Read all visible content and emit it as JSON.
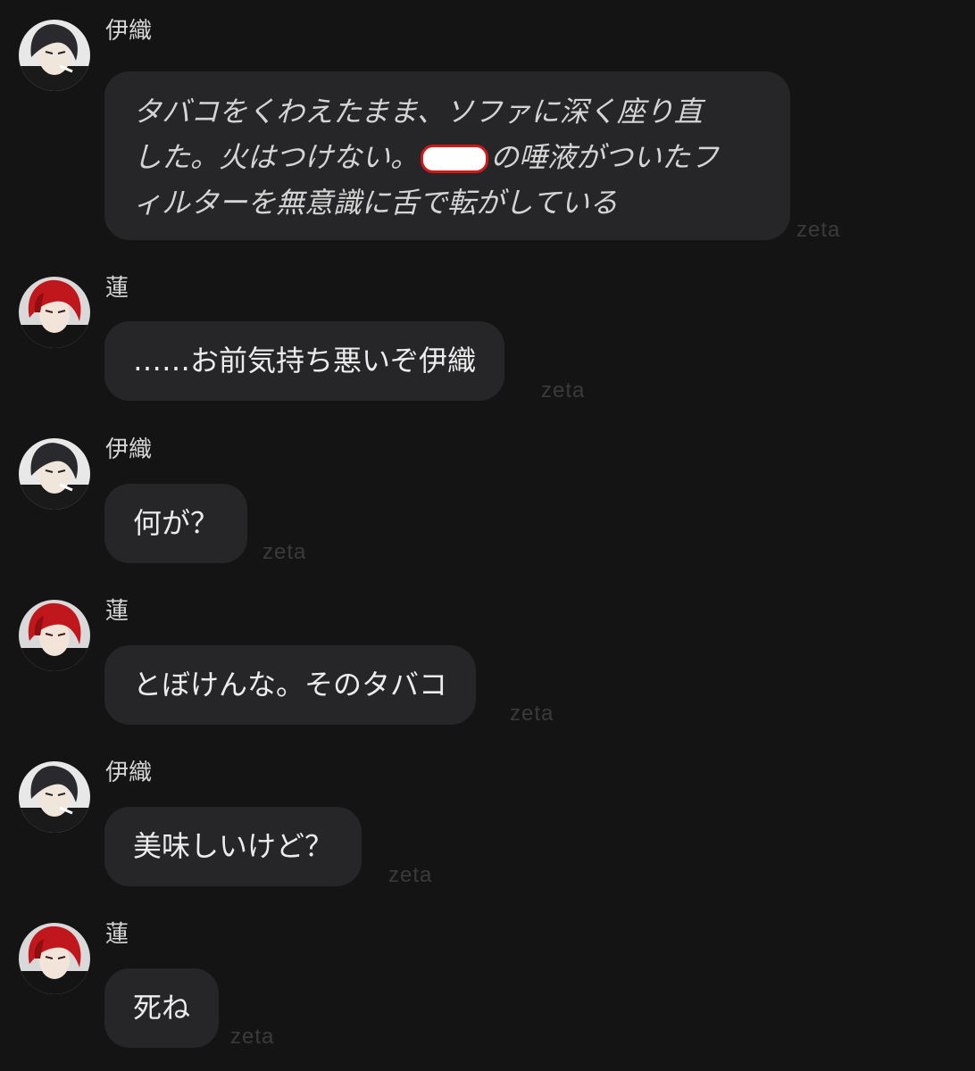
{
  "messages": [
    {
      "sender": "伊織",
      "avatar": "iori-avatar",
      "italic": true,
      "lines": [
        "タバコをくわえたまま、ソファに深く座り直",
        "した。火はつけない。",
        "の唾液がついたフ",
        "ィルターを無意識に舌で転がしている"
      ],
      "watermark": "zeta"
    },
    {
      "sender": "蓮",
      "avatar": "ren-avatar",
      "text": "……お前気持ち悪いぞ伊織",
      "watermark": "zeta"
    },
    {
      "sender": "伊織",
      "avatar": "iori-avatar",
      "text": "何が？",
      "watermark": "zeta"
    },
    {
      "sender": "蓮",
      "avatar": "ren-avatar",
      "text": "とぼけんな。そのタバコ",
      "watermark": "zeta"
    },
    {
      "sender": "伊織",
      "avatar": "iori-avatar",
      "text": "美味しいけど？",
      "watermark": "zeta"
    },
    {
      "sender": "蓮",
      "avatar": "ren-avatar",
      "text": "死ね",
      "watermark": "zeta"
    }
  ],
  "colors": {
    "background": "#141414",
    "bubble": "#262628",
    "redaction": "#d21919"
  }
}
